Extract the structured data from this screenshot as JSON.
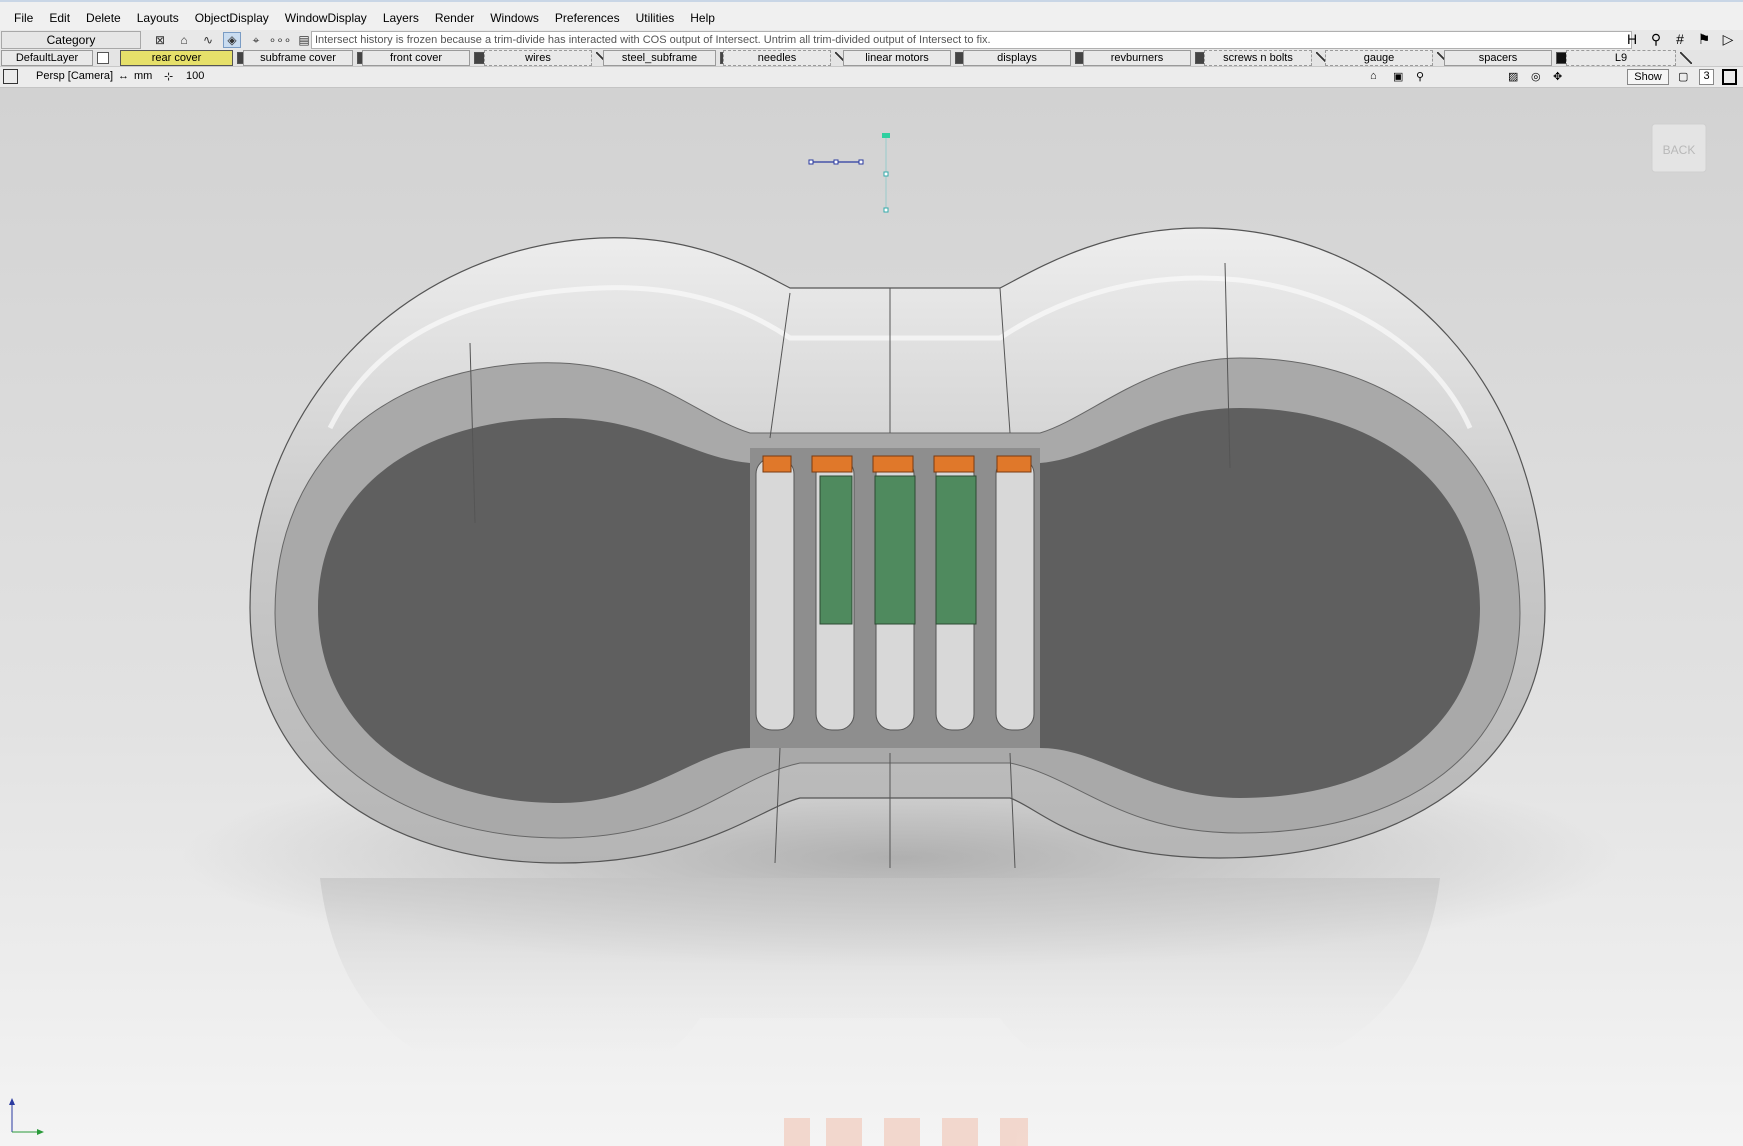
{
  "menu": [
    "File",
    "Edit",
    "Delete",
    "Layouts",
    "ObjectDisplay",
    "WindowDisplay",
    "Layers",
    "Render",
    "Windows",
    "Preferences",
    "Utilities",
    "Help"
  ],
  "info": {
    "category_label": "Category",
    "status_message": "Intersect history is frozen because a trim-divide has interacted with COS output of Intersect.  Untrim all trim-divided output of Intersect to fix."
  },
  "layers": [
    {
      "label": "DefaultLayer",
      "active": false,
      "dashed": false,
      "swatch": "#ffffff"
    },
    {
      "label": "rear cover",
      "active": true,
      "dashed": false,
      "swatch": "#444444"
    },
    {
      "label": "subframe cover",
      "active": false,
      "dashed": false,
      "swatch": "#444444"
    },
    {
      "label": "front cover",
      "active": false,
      "dashed": false,
      "swatch": "#444444"
    },
    {
      "label": "wires",
      "active": false,
      "dashed": true,
      "swatch": "none"
    },
    {
      "label": "steel_subframe",
      "active": false,
      "dashed": false,
      "swatch": "#444444"
    },
    {
      "label": "needles",
      "active": false,
      "dashed": true,
      "swatch": "none"
    },
    {
      "label": "linear motors",
      "active": false,
      "dashed": false,
      "swatch": "#444444"
    },
    {
      "label": "displays",
      "active": false,
      "dashed": false,
      "swatch": "#444444"
    },
    {
      "label": "revburners",
      "active": false,
      "dashed": false,
      "swatch": "#444444"
    },
    {
      "label": "screws n bolts",
      "active": false,
      "dashed": true,
      "swatch": "none"
    },
    {
      "label": "gauge",
      "active": false,
      "dashed": true,
      "swatch": "none"
    },
    {
      "label": "spacers",
      "active": false,
      "dashed": false,
      "swatch": "#111111"
    },
    {
      "label": "L9",
      "active": false,
      "dashed": true,
      "swatch": "none"
    }
  ],
  "view": {
    "camera": "Persp [Camera]",
    "units": "mm",
    "zoom": "100",
    "show_label": "Show",
    "count": "3"
  },
  "viewcube": {
    "label": "BACK"
  },
  "colors": {
    "accent_layer": "#e6e06a",
    "shell": "#cfcfcf",
    "cavity": "#5e5e5e",
    "orange": "#e0782a",
    "green": "#4f8a5e"
  }
}
